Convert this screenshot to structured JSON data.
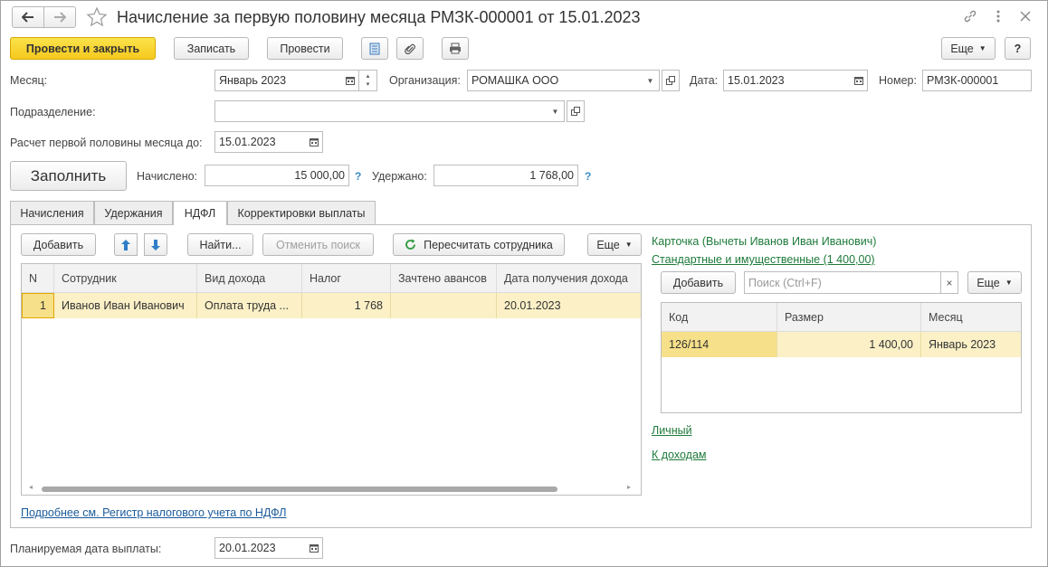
{
  "window": {
    "title": "Начисление за первую половину месяца РМЗК-000001 от 15.01.2023"
  },
  "toolbar": {
    "post_close": "Провести и закрыть",
    "save": "Записать",
    "post": "Провести",
    "more": "Еще",
    "help": "?"
  },
  "header": {
    "month_label": "Месяц:",
    "month_value": "Январь 2023",
    "org_label": "Организация:",
    "org_value": "РОМАШКА ООО",
    "date_label": "Дата:",
    "date_value": "15.01.2023",
    "number_label": "Номер:",
    "number_value": "РМЗК-000001",
    "dept_label": "Подразделение:",
    "dept_value": "",
    "calc_until_label": "Расчет первой половины месяца до:",
    "calc_until_value": "15.01.2023",
    "fill_button": "Заполнить",
    "accrued_label": "Начислено:",
    "accrued_value": "15 000,00",
    "withheld_label": "Удержано:",
    "withheld_value": "1 768,00",
    "q_mark": "?"
  },
  "tabs": [
    {
      "label": "Начисления"
    },
    {
      "label": "Удержания"
    },
    {
      "label": "НДФЛ"
    },
    {
      "label": "Корректировки выплаты"
    }
  ],
  "ndfl": {
    "add": "Добавить",
    "find": "Найти...",
    "cancel_search": "Отменить поиск",
    "recalc": "Пересчитать сотрудника",
    "more": "Еще",
    "columns": [
      "N",
      "Сотрудник",
      "Вид дохода",
      "Налог",
      "Зачтено авансов",
      "Дата получения дохода"
    ],
    "rows": [
      {
        "n": "1",
        "employee": "Иванов Иван Иванович",
        "income": "Оплата труда ...",
        "tax": "1 768",
        "advances": "",
        "date": "20.01.2023"
      }
    ],
    "register_link": "Подробнее см. Регистр налогового учета по НДФЛ"
  },
  "card": {
    "title": "Карточка (Вычеты Иванов Иван Иванович)",
    "std_link": "Стандартные и имущественные (1 400,00)",
    "add": "Добавить",
    "search_placeholder": "Поиск (Ctrl+F)",
    "more": "Еще",
    "columns": [
      "Код",
      "Размер",
      "Месяц"
    ],
    "rows": [
      {
        "code": "126/114",
        "amount": "1 400,00",
        "month": "Январь 2023"
      }
    ],
    "personal_link": "Личный",
    "income_link": "К доходам"
  },
  "footer": {
    "pay_date_label": "Планируемая дата выплаты:",
    "pay_date_value": "20.01.2023"
  },
  "colors": {
    "accent_yellow": "#f5c91e",
    "row_highlight": "#fbf0c6",
    "link_green": "#1d7a3a",
    "link_blue": "#1a5a9a"
  }
}
